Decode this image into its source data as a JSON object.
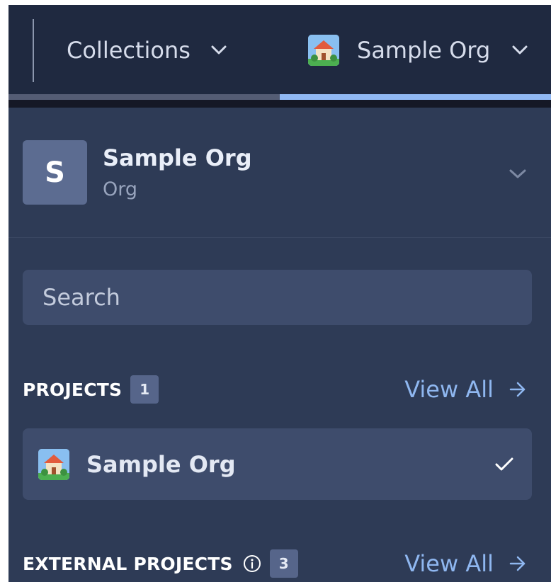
{
  "topbar": {
    "collections_label": "Collections",
    "org_label": "Sample Org",
    "progress_fraction": 0.5
  },
  "org_header": {
    "avatar_letter": "S",
    "name": "Sample Org",
    "type": "Org"
  },
  "search": {
    "placeholder": "Search"
  },
  "projects": {
    "title": "PROJECTS",
    "count": "1",
    "view_all_label": "View All",
    "items": [
      {
        "name": "Sample Org",
        "selected": true
      }
    ]
  },
  "external_projects": {
    "title": "EXTERNAL PROJECTS",
    "count": "3",
    "view_all_label": "View All"
  },
  "icons": {
    "chevron": "chevron-down-icon",
    "org": "house-icon",
    "arrow": "arrow-right-icon",
    "check": "checkmark-icon",
    "info": "info-icon"
  },
  "colors": {
    "background": "#2e3b56",
    "topbar": "#1f2940",
    "accent": "#8fb7f0",
    "progress": "#90b8f4"
  }
}
